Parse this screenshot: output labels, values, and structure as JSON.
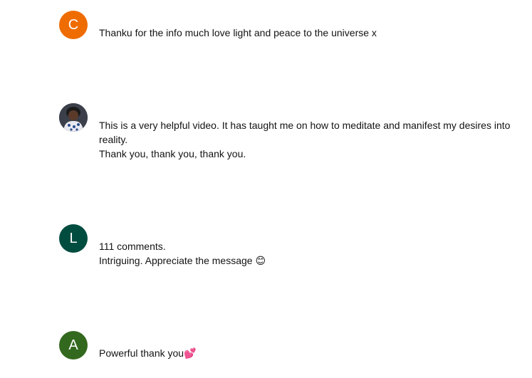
{
  "comments": [
    {
      "avatar_letter": "C",
      "avatar_color": "#ef6c00",
      "lines": [
        "Thanku for the info much love light and peace to the universe x"
      ]
    },
    {
      "avatar_letter": "",
      "avatar_color": "#2e3440",
      "lines": [
        "This is a very helpful video. It has taught me on how to meditate and manifest my desires into reality.",
        "Thank you, thank you, thank you."
      ]
    },
    {
      "avatar_letter": "L",
      "avatar_color": "#004d40",
      "lines": [
        "111 comments.",
        "Intriguing. Appreciate the message 😊"
      ]
    },
    {
      "avatar_letter": "A",
      "avatar_color": "#33691e",
      "lines": [
        "Powerful thank you💕"
      ]
    }
  ]
}
